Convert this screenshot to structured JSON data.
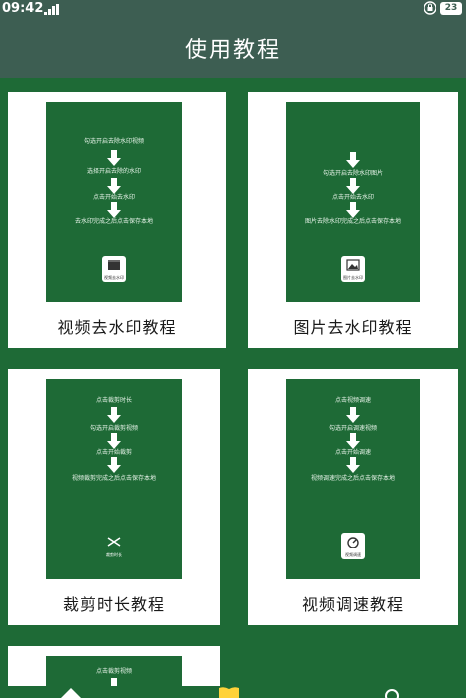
{
  "status_bar": {
    "time": "09:42",
    "battery": "23"
  },
  "header": {
    "title": "使用教程"
  },
  "cards": [
    {
      "title": "视频去水印教程",
      "steps": [
        "勾选开启去除水印视频",
        "选择开启去除的水印",
        "点击开始去水印",
        "去水印完成之后点击保存本地"
      ],
      "button_label": "视频去水印"
    },
    {
      "title": "图片去水印教程",
      "steps": [
        "勾选开启去除水印图片",
        "点击开始去水印",
        "图片去除水印完成之后点击保存本地"
      ],
      "button_label": "图片去水印"
    },
    {
      "title": "裁剪时长教程",
      "steps": [
        "点击裁剪时长",
        "勾选开启裁剪视频",
        "点击开始裁剪",
        "视频裁剪完成之后点击保存本地"
      ],
      "button_label": "裁剪时长"
    },
    {
      "title": "视频调速教程",
      "steps": [
        "点击视频调速",
        "勾选开启调速视频",
        "点击开始调速",
        "视频调速完成之后点击保存本地"
      ],
      "button_label": "视频调速"
    },
    {
      "title": "",
      "steps": [
        "点击裁剪视频"
      ],
      "button_label": ""
    }
  ],
  "colors": {
    "header": "#3d5e52",
    "background": "#1e6a36",
    "card": "#ffffff"
  }
}
